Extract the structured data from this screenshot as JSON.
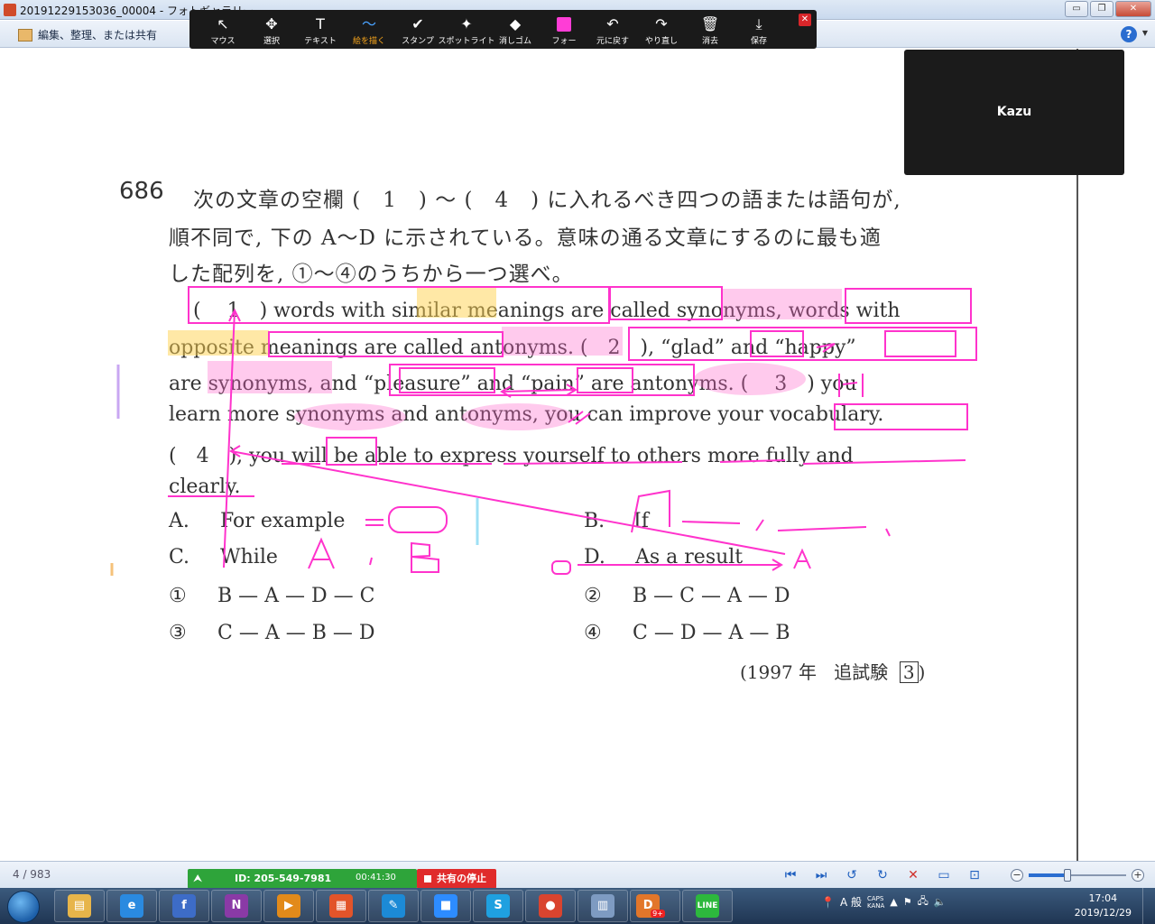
{
  "window": {
    "title": "20191229153036_00004 - フォトギャラリー",
    "minimize": "▭",
    "maximize": "❐",
    "close": "✕"
  },
  "command_bar": {
    "organize_label": "編集、整理、または共有",
    "help": "?"
  },
  "annotation_toolbar": {
    "tools": [
      {
        "id": "mouse",
        "icon": "↖",
        "label": "マウス"
      },
      {
        "id": "select",
        "icon": "✥",
        "label": "選択"
      },
      {
        "id": "text",
        "icon": "T",
        "label": "テキスト"
      },
      {
        "id": "draw",
        "icon": "〜",
        "label": "絵を描く",
        "active": true
      },
      {
        "id": "stamp",
        "icon": "✔",
        "label": "スタンプ"
      },
      {
        "id": "spotlight",
        "icon": "✦",
        "label": "スポットライト"
      },
      {
        "id": "eraser",
        "icon": "◆",
        "label": "消しゴム"
      },
      {
        "id": "format",
        "icon": "",
        "label": "フォー"
      },
      {
        "id": "undo",
        "icon": "↶",
        "label": "元に戻す"
      },
      {
        "id": "redo",
        "icon": "↷",
        "label": "やり直し"
      },
      {
        "id": "clear",
        "icon": "🗑",
        "label": "消去"
      },
      {
        "id": "save",
        "icon": "⤓",
        "label": "保存"
      }
    ],
    "pen_color": "#ff3dd6",
    "close": "✕"
  },
  "speaker": {
    "name": "Kazu"
  },
  "document": {
    "question_number": "686",
    "instructions": [
      "次の文章の空欄 (　1　) ～ (　4　) に入れるべき四つの語または語句が,",
      "順不同で, 下の A～D に示されている。意味の通る文章にするのに最も適",
      "した配列を, ①～④のうちから一つ選べ。"
    ],
    "passage_lines": [
      "(　 1　) words with similar meanings are called synonyms, words with",
      "opposite meanings are called antonyms. (　2　), “glad” and “happy”",
      "are synonyms, and “pleasure” and “pain” are antonyms. (　 3　) you",
      "learn more synonyms and antonyms, you can improve your vocabulary.",
      "(　4　), you will be able to express yourself to others more fully and",
      "clearly."
    ],
    "options": {
      "A": {
        "letter": "A.",
        "text": "For example"
      },
      "B": {
        "letter": "B.",
        "text": "If"
      },
      "C": {
        "letter": "C.",
        "text": "While"
      },
      "D": {
        "letter": "D.",
        "text": "As a result"
      }
    },
    "answers": [
      {
        "mark": "①",
        "seq": "B — A — D — C"
      },
      {
        "mark": "②",
        "seq": "B — C — A — D"
      },
      {
        "mark": "③",
        "seq": "C — A — B — D"
      },
      {
        "mark": "④",
        "seq": "C — D — A — B"
      }
    ],
    "source": {
      "year": "(1997 年",
      "exam": "追試験",
      "num": "3",
      "close": ")"
    },
    "handwriting": {
      "answer_4": "A",
      "ab_c": "A，B",
      "d_arrow": "A",
      "three_note": "If"
    }
  },
  "status_bar": {
    "page_count": "4 / 983",
    "zoom_level": 0.4
  },
  "share": {
    "id_label": "ID: 205-549-7981",
    "time": "00:41:30",
    "stop_label": "共有の停止"
  },
  "taskbar": {
    "apps": [
      {
        "name": "explorer",
        "glyph": "▤",
        "color": "#e7b54a"
      },
      {
        "name": "internet-explorer",
        "glyph": "e",
        "color": "#2a8ae0"
      },
      {
        "name": "app-red",
        "glyph": "f",
        "color": "#3d6cc7"
      },
      {
        "name": "onenote",
        "glyph": "N",
        "color": "#8a3aa6"
      },
      {
        "name": "media-player",
        "glyph": "▶",
        "color": "#e28a1a"
      },
      {
        "name": "paint",
        "glyph": "▦",
        "color": "#e2542a"
      },
      {
        "name": "feather-app",
        "glyph": "✎",
        "color": "#1c8ad6"
      },
      {
        "name": "zoom",
        "glyph": "■",
        "color": "#2d8cff"
      },
      {
        "name": "skype",
        "glyph": "S",
        "color": "#1fa0e0"
      },
      {
        "name": "chrome",
        "glyph": "●",
        "color": "#d9442f"
      },
      {
        "name": "archive",
        "glyph": "▥",
        "color": "#7e9bc2"
      },
      {
        "name": "app-d",
        "glyph": "D",
        "color": "#e2762a",
        "badge": "9+"
      },
      {
        "name": "line",
        "glyph": "LINE",
        "color": "#2db83d"
      }
    ],
    "ime": "A 般",
    "caps": "CAPS",
    "kana": "KANA",
    "time": "17:04",
    "date": "2019/12/29"
  }
}
